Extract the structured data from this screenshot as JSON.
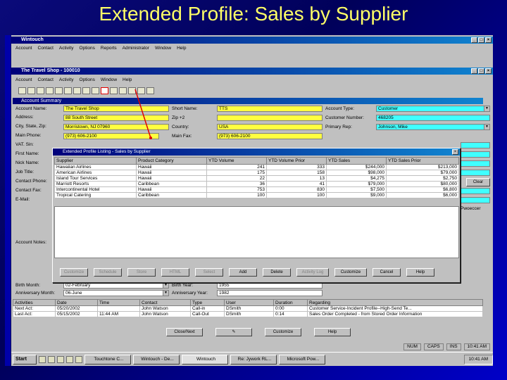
{
  "slide": {
    "title": "Extended Profile: Sales by Supplier"
  },
  "outer_window": {
    "title": "Wintouch",
    "menu": [
      "Account",
      "Contact",
      "Activity",
      "Options",
      "Reports",
      "Administrator",
      "Window",
      "Help"
    ]
  },
  "inner_window": {
    "title": "The Travel Shop - 100010",
    "menu": [
      "Account",
      "Contact",
      "Activity",
      "Options",
      "Window",
      "Help"
    ]
  },
  "account_summary": {
    "section_title": "Account Summary",
    "labels": {
      "account_name": "Account Name:",
      "address": "Address:",
      "city": "City, State, Zip:",
      "main_phone": "Main Phone:",
      "vat": "VAT. Sin:",
      "first_name": "First Name:",
      "nick_name": "Nick Name:",
      "job_title": "Job Title:",
      "contact_phone": "Contact Phone:",
      "contact_fax": "Contact Fax:",
      "email": "E-Mail:",
      "account_notes": "Account Notes:",
      "short_name": "Short Name:",
      "zip4": "Zip +2",
      "country": "Country:",
      "main_fax": "Main Fax:",
      "account_type": "Account Type:",
      "customer_number": "Customer Number:",
      "primary_rep": "Primary Rep:",
      "birth_month": "Birth Month:",
      "anniversary_month": "Anniversary Month:",
      "birth_year": "Birth Year:",
      "anniversary_year": "Anniversary Year:"
    },
    "values": {
      "account_name": "The Travel Shop",
      "address": "88 South Street",
      "city": "Morristown, NJ 07960",
      "main_phone": "(973) 606-2100",
      "short_name": "TTS",
      "country": "USA",
      "main_fax": "(973) 606-2100",
      "account_type": "Customer",
      "customer_number": "468205",
      "primary_rep": "Johnson, Mike",
      "birth_month": "02-February",
      "anniversary_month": "06-June",
      "birth_year": "1955",
      "anniversary_year": "1982",
      "clear_label": "Clear",
      "right_note": "Pwoeccer"
    }
  },
  "dialog": {
    "title": "Extended Profile Listing - Sales by Supplier",
    "columns": [
      "Supplier",
      "Product Category",
      "YTD Volume",
      "YTD Volume Prior",
      "YTD Sales",
      "YTD Sales Prior"
    ],
    "rows": [
      [
        "Hawaiian Airlines",
        "Hawaii",
        "241",
        "333",
        "$244,000",
        "$213,000"
      ],
      [
        "American Airlines",
        "Hawaii",
        "175",
        "158",
        "$98,000",
        "$79,000"
      ],
      [
        "Island Tour Services",
        "Hawaii",
        "22",
        "13",
        "$4,275",
        "$2,750"
      ],
      [
        "Marriott Resorts",
        "Caribbean",
        "36",
        "41",
        "$79,000",
        "$80,000"
      ],
      [
        "Intercontinental Hotel",
        "Hawaii",
        "753",
        "830",
        "$7,500",
        "$6,800"
      ],
      [
        "Tropical Catering",
        "Caribbean",
        "100",
        "100",
        "$9,000",
        "$6,000"
      ]
    ],
    "buttons": [
      "Customize",
      "Schedule",
      "Store",
      "HTML",
      "Select",
      "Add",
      "Delete",
      "Activity Log",
      "Customize",
      "Cancel",
      "Help"
    ]
  },
  "activities": {
    "columns": [
      "Activities",
      "Date",
      "Time",
      "Contact",
      "Type",
      "User",
      "Duration",
      "Regarding"
    ],
    "rows": [
      [
        "Next Act:",
        "05/20/2002",
        "",
        "John Watson",
        "Call-in",
        "DSmith",
        "0:00",
        "Customer Service-Incident Profile--High-Send Te..."
      ],
      [
        "Last Act:",
        "05/15/2002",
        "11:44 AM",
        "John Watson",
        "Call-Out",
        "DSmith",
        "0:14",
        "Sales Order Completed - from Stored Order Information"
      ]
    ],
    "buttons": [
      "Close/Next",
      "Customize",
      "Help"
    ]
  },
  "statusbar": [
    "NUM",
    "CAPS",
    "INS",
    "10:41 AM"
  ],
  "taskbar": {
    "start": "Start",
    "tasks": [
      "Touchtone C...",
      "Wintouch - De...",
      "Wintouch",
      "Re: Jywork RL...",
      "Microsoft Pow..."
    ],
    "clock": "10:41 AM"
  },
  "colors": {
    "field_yellow": "#ffff40",
    "field_cyan": "#40ffff",
    "titlebar": "#00007a",
    "pointer": "#e00000"
  }
}
